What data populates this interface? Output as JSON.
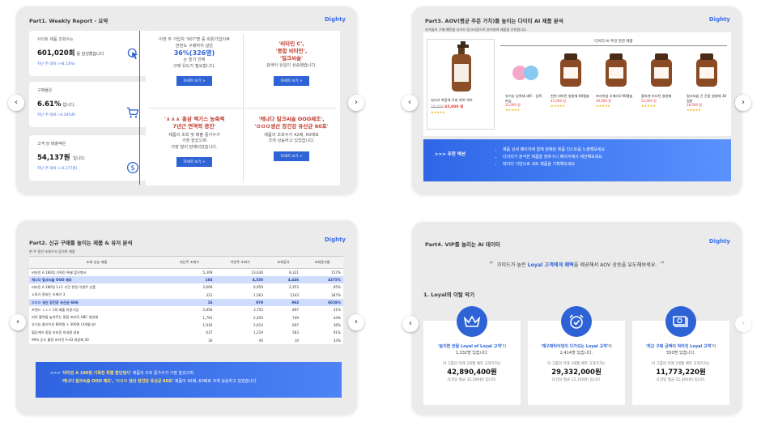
{
  "logo": "Dighty",
  "slide1": {
    "title": "Part1. Weekly Report - 요약",
    "kpis": [
      {
        "label": "사이트 제품 조회수는",
        "value": "601,020회",
        "suffix": "를 달성했습니다",
        "compare": "지난 주 대비 (+8.13%)",
        "icon": "cursor-click-icon"
      },
      {
        "label": "구매율은",
        "value": "6.61%",
        "suffix": "입니다.",
        "compare": "지난 주 대비 (-0.34%P)",
        "icon": ""
      },
      {
        "label": "고객 당 매출액은",
        "value": "54,137원",
        "suffix": " 입니다.",
        "compare": "지난 주 대비 (+3,177원)",
        "icon": "cart-icon"
      }
    ],
    "cells": [
      {
        "pre": "이번 주 가입자 '907'명 중 회원가입이후 한번도 구매하지 않은",
        "highlight": "36%(326명)",
        "post1": "는 높기 전에",
        "post2": "구매 유도가 필요합니다.",
        "button": "자세히 보기 >"
      },
      {
        "highlight": "'비타민 C',\n'종합 비타민',\n'밀크씨슬'",
        "post2": "검색어 유입이 상승했습니다.",
        "button": "자세히 보기 >"
      },
      {
        "highlight": "'ㅿㅿㅿ 홍삼 엑기스 농축액\n7년근 면역력 증진'",
        "post1": "제품의 조회 및 매출 증가수가\n가장 높았으며",
        "post2": "가장 많이 판매되었습니다.",
        "button": "자세히 보기 >"
      },
      {
        "highlight": "'캐나다 밀크씨슬 OOO제조',\n'ㅁㅁㅁ생산 장건강 유산균 60포'",
        "post1": "제품의 조회수가 42배, 60배로",
        "post2": "크게 상승하고 있었습니다.",
        "button": "자세히 보기 >"
      }
    ]
  },
  "slide2": {
    "title": "Part3. AOV(평균 주문 가치)를 높이는 다이티 AI 제품 분석",
    "subtitle": "유저들의 구매 패턴을 다이티 알고리즘으로 분석하여 제품을 추천합니다.",
    "main_product": {
      "name": "실리카 복합체 모발 회복 케어",
      "old_price": "78,000",
      "price": "65,000 원"
    },
    "list_title": "다이티 AI 추천 연관 제품",
    "items": [
      {
        "name": "유기농 입욕제 세트 - 입욕 보습",
        "price": "32,000 원"
      },
      {
        "name": "천연 비타민 영양제 60캡슐",
        "price": "45,000 원"
      },
      {
        "name": "프리미엄 오메가3 90캡슐",
        "price": "39,000 원"
      },
      {
        "name": "콜라겐 비오틴 영양제",
        "price": "52,000 원"
      },
      {
        "name": "밀크씨슬 간 건강 영양제 30일분",
        "price": "28,000 원"
      }
    ],
    "rec_label": ">>> 추천 액션",
    "rec_lines": [
      "제품 상세 페이지에 함께 판매된 제품 리스트를 노출해보세요",
      "다이티가 분석한 제품을 장바구니 페이지에서 제안해보세요",
      "데이터 기반으로 세트 제품을 기획해보세요"
    ]
  },
  "slide3": {
    "title": "Part2. 신규 구매를 높이는 제품 & 유저 분석",
    "subtitle": "한 주 동안 조회수가 증가한 제품",
    "headers": [
      "조회 상승 제품",
      "지난주 조회수",
      "이번주 조회수",
      "조회증가",
      "조회증가율"
    ],
    "rows": [
      [
        "비타민 A 180정 기획전 특별 할인행사",
        "5,309",
        "13,630",
        "8,321",
        "157%"
      ],
      [
        "캐나다 밀크씨슬 OOO 제조",
        "104",
        "4,550",
        "4,446",
        "4275%"
      ],
      [
        "비타민 A 180정 1+1 기간 한정 이벤트 상품",
        "3,606",
        "6,959",
        "2,353",
        "65%"
      ],
      [
        "소화가 잘되는 오메가 3",
        "321",
        "1,563",
        "1243",
        "387%"
      ],
      [
        "ㅁㅁㅁ 생산 장건강 유산균 60포",
        "16",
        "979",
        "963",
        "6019%"
      ],
      [
        "프렌드 ㅿㅿㅿ 1위 매출 미용기업",
        "2,858",
        "3,755",
        "897",
        "31%"
      ],
      [
        "피로 활력을 높여주는 종합 비타민 ABC 영양제",
        "1,791",
        "2,450",
        "749",
        "44%"
      ],
      [
        "유기농 올리브유 800원 + 300원 (3개월 분)",
        "1,916",
        "2,614",
        "697",
        "36%"
      ],
      [
        "혈당케어 종합 비타민 미네랄 영표",
        "637",
        "1,219",
        "583",
        "91%"
      ],
      [
        "99% 순도 활량 비타민 A+D 영양제 30",
        "30",
        "40",
        "10",
        "33%"
      ]
    ],
    "highlight_rows": [
      1,
      4
    ],
    "banner_prefix": ">>>",
    "banner_y1": "'비타민 A 180정 기획전 특별 할인행사'",
    "banner_t1": " 제품의 조회 증가수가 가장 높았으며",
    "banner_y2": "'캐나다 밀크씨슬 OOO 제조', 'ㅁㅁㅁ 생산 장건강 유산균 60포'",
    "banner_t2": " 제품이 42배, 60배로 크게 상승하고 있었습니다."
  },
  "slide4": {
    "title": "Part4. VIP를 늘리는 AI 데이터",
    "quote_pre": "가이드가 높은 ",
    "quote_bold": "Loyal 고객에게 혜택",
    "quote_post": "을 제공해서 AOV 상승을 유도해보세요.",
    "section": "1. Loyal의 이탈 막기",
    "cards": [
      {
        "icon": "crown-icon",
        "quoted": "'늘지면 안될 Loyal of Loyal 고객'",
        "post": "이",
        "count": "1,332명 있습니다.",
        "note": "이 그룹의 미래 3개월 예측 고객가치는",
        "value": "42,890,400원",
        "avg": "(1인당 평균 32,200원) 입니다."
      },
      {
        "icon": "alarm-check-icon",
        "quoted": "'재구매타이밍이 다가오는 Loyal 고객'",
        "post": "이",
        "count": "2,414명 있습니다.",
        "note": "이 그룹의 미래 3개월 예측 고객가치는",
        "value": "29,332,000원",
        "avg": "(1인당 평균 12,150원) 입니다."
      },
      {
        "icon": "money-icon",
        "quoted": "'최근 구매 금액이 작아진 Loyal 고객'",
        "post": "이",
        "count": "550명 있습니다.",
        "note": "이 그룹의 미래 3개월 예측 고객가치는",
        "value": "11,773,220원",
        "avg": "(1인당 평균 21,405원) 입니다."
      }
    ]
  },
  "nav": {
    "prev": "‹",
    "next": "›"
  }
}
